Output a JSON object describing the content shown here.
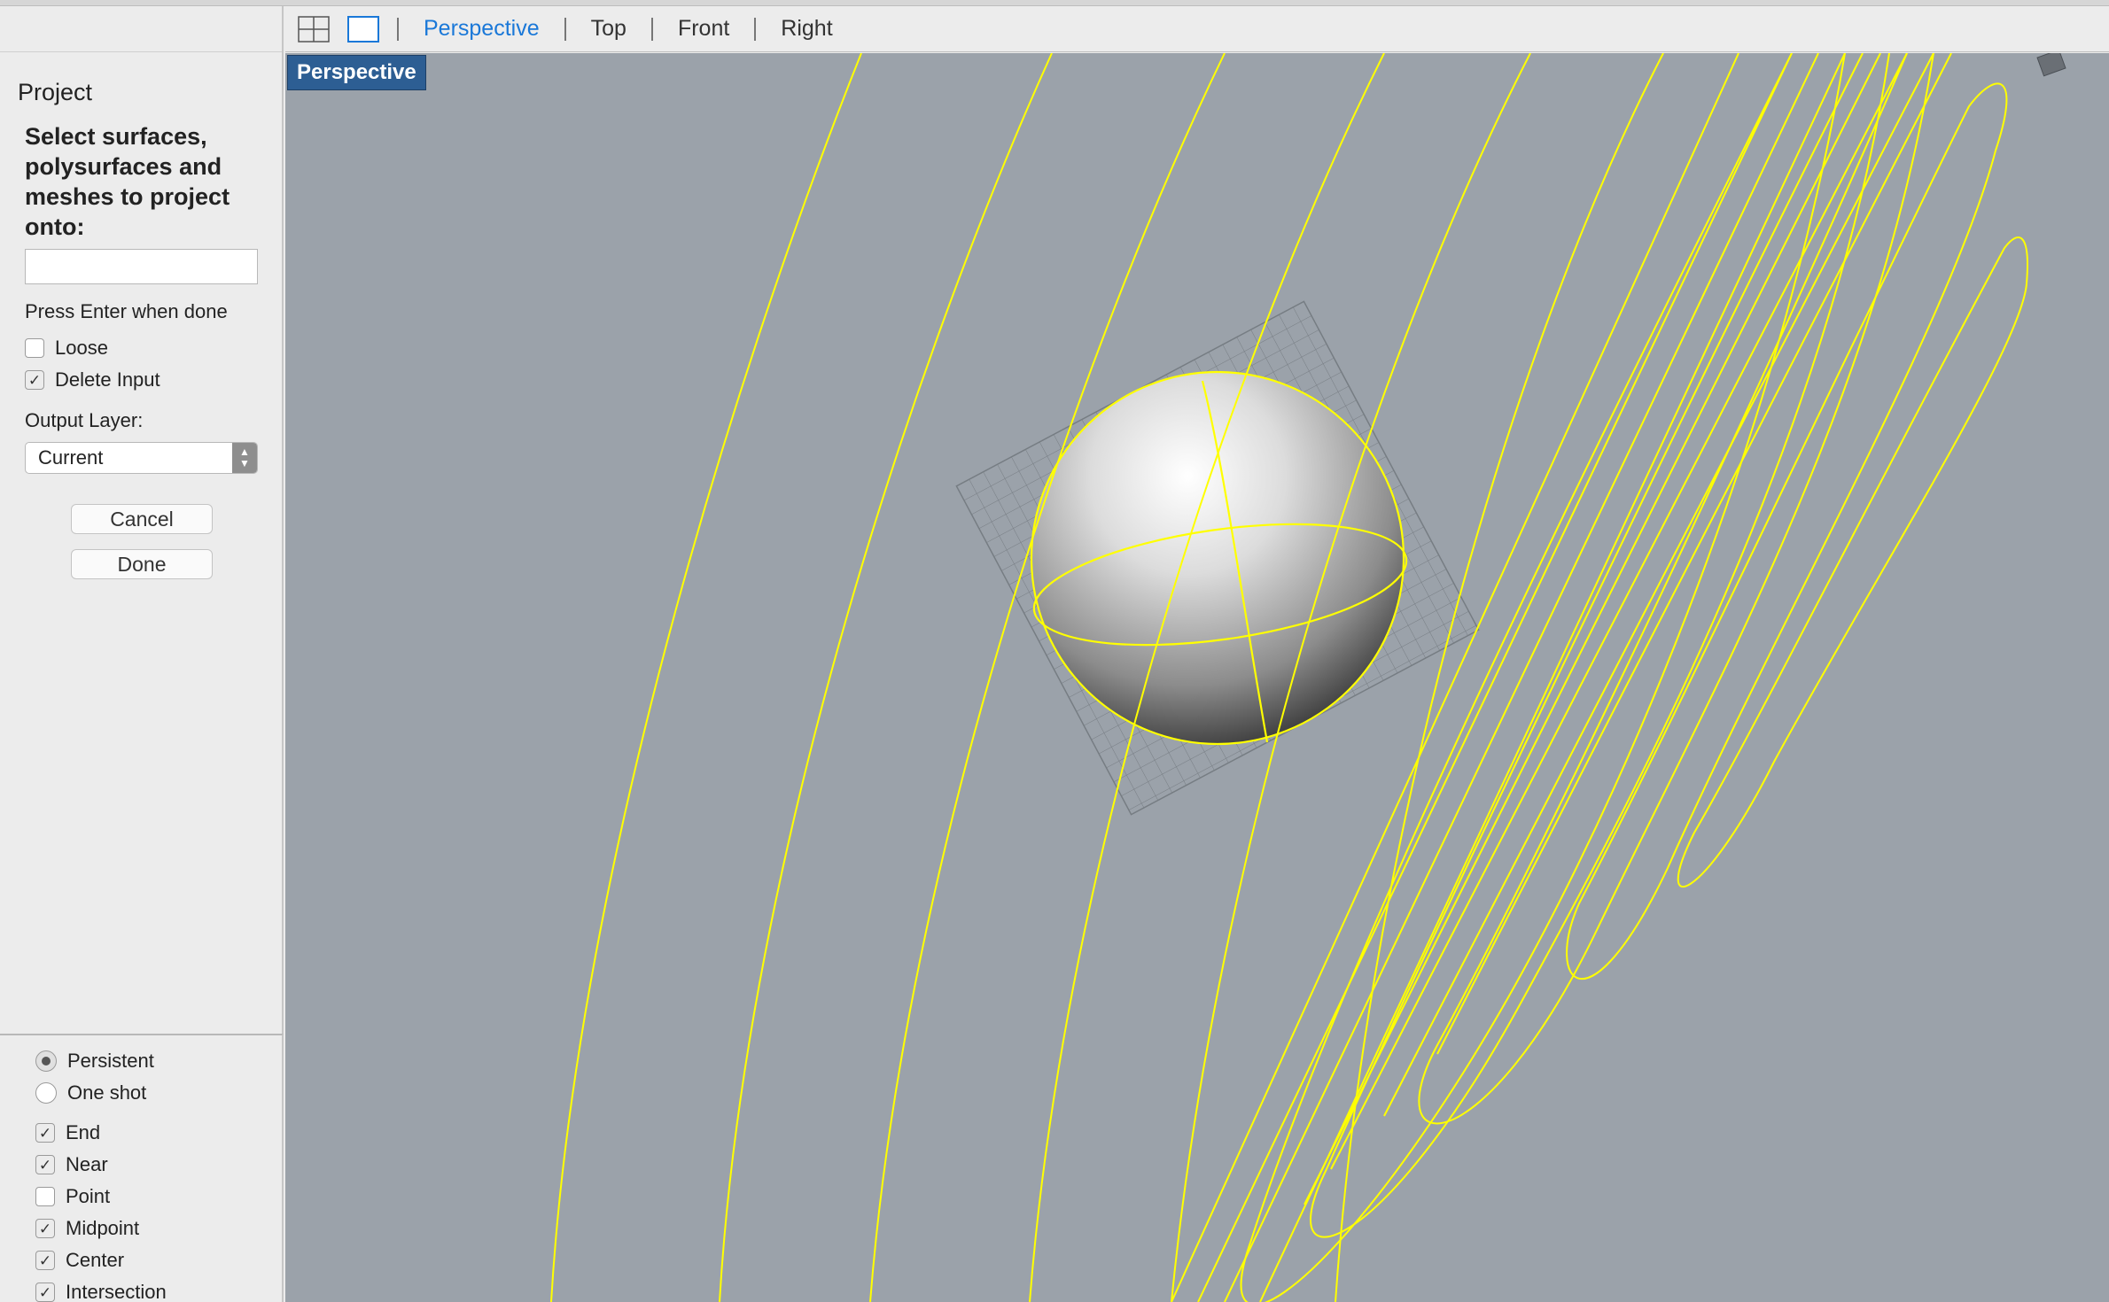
{
  "command_panel": {
    "title": "Project",
    "prompt": "Select surfaces, polysurfaces and meshes to project onto:",
    "input_value": "",
    "hint": "Press Enter when done",
    "options": [
      {
        "label": "Loose",
        "checked": false
      },
      {
        "label": "Delete Input",
        "checked": true
      }
    ],
    "output_layer_label": "Output Layer:",
    "output_layer_value": "Current",
    "cancel_label": "Cancel",
    "done_label": "Done"
  },
  "osnap": {
    "modes": [
      {
        "label": "Persistent",
        "selected": true
      },
      {
        "label": "One shot",
        "selected": false
      }
    ],
    "snaps": [
      {
        "label": "End",
        "checked": true
      },
      {
        "label": "Near",
        "checked": true
      },
      {
        "label": "Point",
        "checked": false
      },
      {
        "label": "Midpoint",
        "checked": true
      },
      {
        "label": "Center",
        "checked": true
      },
      {
        "label": "Intersection",
        "checked": true
      }
    ]
  },
  "viewport_tabs": {
    "tabs": [
      "Perspective",
      "Top",
      "Front",
      "Right"
    ],
    "active": "Perspective"
  },
  "viewport": {
    "label": "Perspective",
    "curve_color": "#ffff00",
    "background": "#9ba2aa"
  }
}
